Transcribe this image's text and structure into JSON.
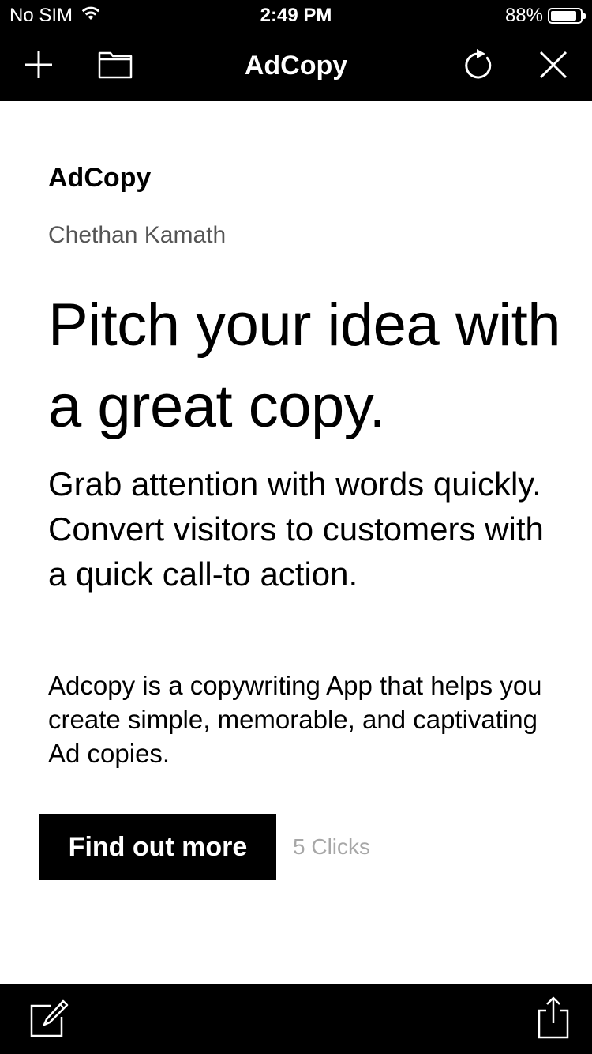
{
  "status_bar": {
    "carrier": "No SIM",
    "time": "2:49 PM",
    "battery_percent": "88%",
    "battery_level": 0.88,
    "wifi_icon": "wifi-icon",
    "battery_icon": "battery-icon"
  },
  "nav_bar": {
    "title": "AdCopy",
    "icons": [
      "plus-icon",
      "folder-icon",
      "refresh-icon",
      "close-icon"
    ]
  },
  "content": {
    "app_name": "AdCopy",
    "author": "Chethan Kamath",
    "headline": "Pitch your idea with a great copy.",
    "subhead": "Grab attention with words quickly. Convert visitors to customers with a quick call-to action.",
    "description": "Adcopy is a copywriting App that helps you create simple, memorable, and captivating Ad copies.",
    "cta_label": "Find out more",
    "clicks_label": "5 Clicks"
  },
  "bottom_bar": {
    "icons": [
      "edit-icon",
      "share-icon"
    ]
  },
  "colors": {
    "bar_background": "#000000",
    "page_background": "#ffffff",
    "text": "#000000",
    "author_text": "#555555",
    "muted_text": "#a7a7a7",
    "button_background": "#000000",
    "button_text": "#ffffff"
  }
}
